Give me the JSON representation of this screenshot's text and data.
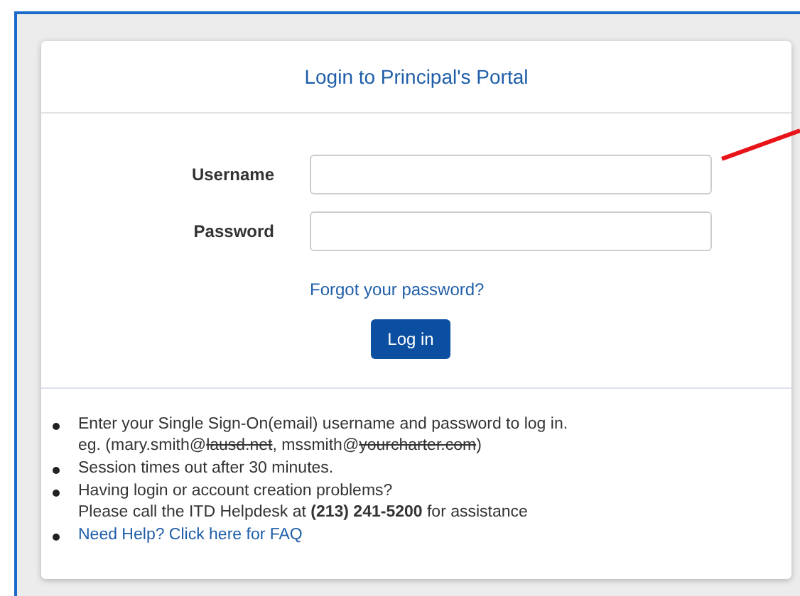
{
  "title": "Login to Principal's Portal",
  "fields": [
    {
      "label": "Username"
    },
    {
      "label": "Password"
    }
  ],
  "forgot_link": "Forgot your password?",
  "login_button": "Log in",
  "notes": [
    {
      "kind": "text",
      "lines": [
        [
          {
            "text": "Enter your Single Sign-On(email) username and password to log in.",
            "struck": false
          }
        ],
        [
          {
            "text": "eg. (mary.smith@",
            "struck": false
          },
          {
            "text": "lausd.net",
            "struck": true
          },
          {
            "text": ", mssmith@",
            "struck": false
          },
          {
            "text": "yourcharter.com",
            "struck": true
          },
          {
            "text": ")",
            "struck": false
          }
        ]
      ]
    },
    {
      "kind": "text",
      "lines": [
        [
          {
            "text": "Session times out after 30 minutes.",
            "struck": false
          }
        ]
      ]
    },
    {
      "kind": "text",
      "lines": [
        [
          {
            "text": "Having login or account creation problems?",
            "struck": false
          }
        ],
        [
          {
            "text": "Please call the ITD Helpdesk at **(213) 241-5200** for assistance",
            "struck": false
          }
        ]
      ]
    },
    {
      "kind": "link",
      "lines": [
        [
          {
            "text": "Need Help? Click here for FAQ",
            "struck": false
          }
        ]
      ]
    }
  ]
}
